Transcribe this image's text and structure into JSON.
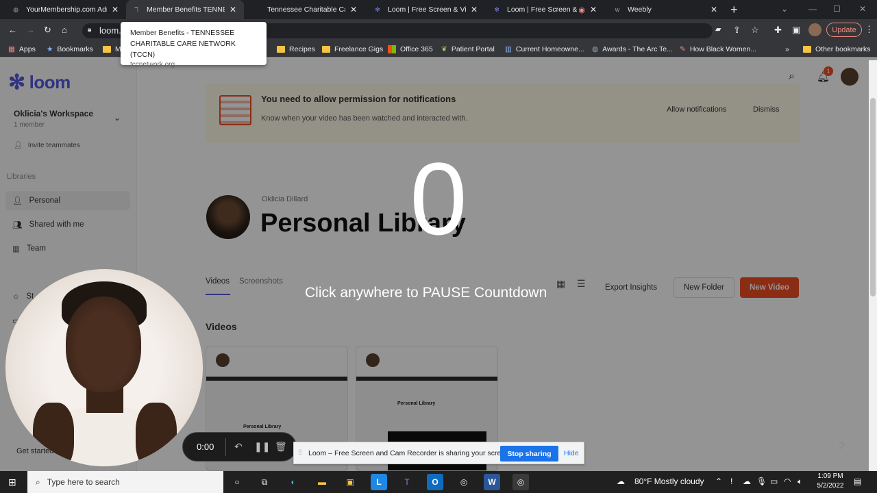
{
  "browser": {
    "tabs": [
      {
        "title": "YourMembership.com Adm",
        "icon": "globe-icon"
      },
      {
        "title": "Member Benefits TENNESS",
        "icon": "tccn-favicon-icon"
      },
      {
        "title": "Tennessee Charitable Care",
        "icon": "tccn-favicon-icon"
      },
      {
        "title": "Loom | Free Screen & Video",
        "icon": "loom-favicon-icon"
      },
      {
        "title": "Loom | Free Screen & V",
        "icon": "loom-favicon-icon"
      },
      {
        "title": "Weebly",
        "icon": "weebly-favicon-icon"
      }
    ],
    "url": "loom.c",
    "update_label": "Update",
    "tooltip": {
      "title": "Member Benefits - TENNESSEE CHARITABLE CARE NETWORK (TCCN)",
      "domain": "tccnetwork.org"
    },
    "bookmarks": [
      {
        "label": "Apps"
      },
      {
        "label": "Bookmarks"
      },
      {
        "label": "M"
      },
      {
        "label": "Recipes"
      },
      {
        "label": "Freelance Gigs"
      },
      {
        "label": "Office 365"
      },
      {
        "label": "Patient Portal"
      },
      {
        "label": "Current Homeowne..."
      },
      {
        "label": "Awards - The Arc Te..."
      },
      {
        "label": "How Black Women..."
      },
      {
        "label": "Other bookmarks"
      }
    ]
  },
  "loom": {
    "logo_text": "loom",
    "workspace": {
      "name": "Oklicia's Workspace",
      "members": "1 member"
    },
    "invite_label": "Invite teammates",
    "libraries_heading": "Libraries",
    "nav": [
      {
        "label": "Personal"
      },
      {
        "label": "Shared with me"
      },
      {
        "label": "Team"
      },
      {
        "label": "St"
      },
      {
        "label": ""
      }
    ],
    "get_started": "Get started",
    "notification_count": "1",
    "banner": {
      "title": "You need to allow permission for notifications",
      "subtitle": "Know when your video has been watched and interacted with.",
      "allow_label": "Allow notifications",
      "dismiss_label": "Dismiss"
    },
    "owner": "Oklicia Dillard",
    "page_title": "Personal Library",
    "tabs": [
      {
        "label": "Videos"
      },
      {
        "label": "Screenshots"
      }
    ],
    "actions": {
      "export": "Export Insights",
      "new_folder": "New Folder",
      "new_video": "New Video"
    },
    "videos_heading": "Videos",
    "card_thumb_label": "Personal Library"
  },
  "recording": {
    "countdown": "0",
    "countdown_message": "Click anywhere to PAUSE Countdown",
    "timer": "0:00"
  },
  "share_bar": {
    "message": "Loom – Free Screen and Cam Recorder is sharing your screen.",
    "stop_label": "Stop sharing",
    "hide_label": "Hide"
  },
  "taskbar": {
    "search_placeholder": "Type here to search",
    "weather": "80°F  Mostly cloudy",
    "time": "1:09 PM",
    "date": "5/2/2022"
  }
}
